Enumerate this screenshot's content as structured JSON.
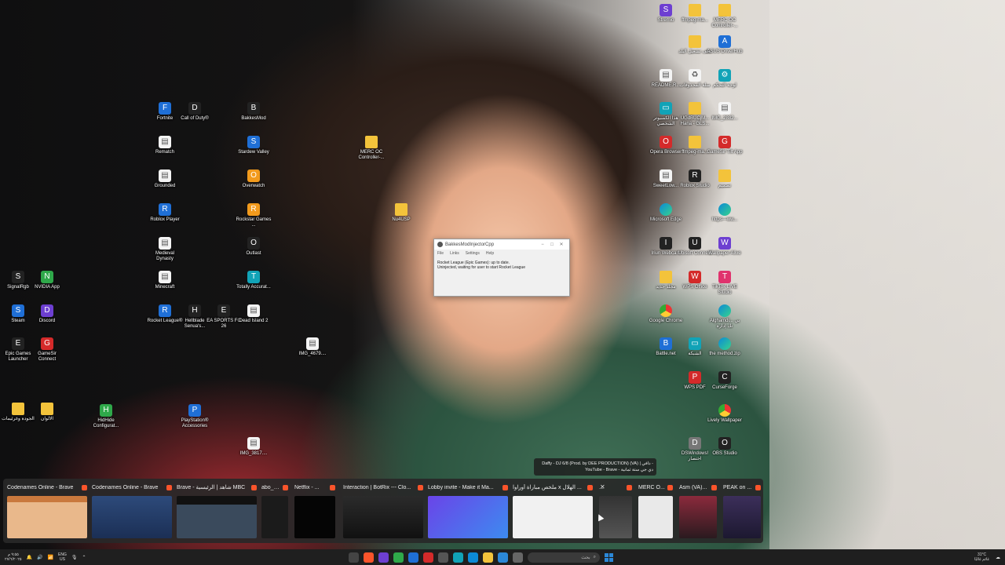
{
  "desktop": {
    "left_icons": [
      {
        "label": "Fortnite",
        "name": "fortnite",
        "cls": "g-blue",
        "glyph": "F"
      },
      {
        "label": "Call of Duty®",
        "name": "call-of-duty",
        "cls": "g-dark",
        "glyph": "D"
      },
      {
        "label": "BakkesMod",
        "name": "bakkesmod",
        "cls": "g-dark",
        "glyph": "B"
      },
      {
        "label": "Rematch",
        "name": "rematch",
        "cls": "g-file",
        "glyph": "▤"
      },
      {
        "label": "Stardew Valley",
        "name": "stardew-valley",
        "cls": "g-blue",
        "glyph": "S"
      },
      {
        "label": "Grounded",
        "name": "grounded",
        "cls": "g-file",
        "glyph": "▤"
      },
      {
        "label": "Overwatch",
        "name": "overwatch",
        "cls": "g-orange",
        "glyph": "O"
      },
      {
        "label": "Roblox Player",
        "name": "roblox-player",
        "cls": "g-blue",
        "glyph": "R"
      },
      {
        "label": "Rockstar Games ...",
        "name": "rockstar-games",
        "cls": "g-orange",
        "glyph": "R"
      },
      {
        "label": "Medieval Dynasty",
        "name": "medieval-dynasty",
        "cls": "g-file",
        "glyph": "▤"
      },
      {
        "label": "Outlast",
        "name": "outlast",
        "cls": "g-dark",
        "glyph": "O"
      },
      {
        "label": "Minecraft",
        "name": "minecraft",
        "cls": "g-file",
        "glyph": "▤"
      },
      {
        "label": "Totally Accurat...",
        "name": "totally-accurate",
        "cls": "g-teal",
        "glyph": "T"
      },
      {
        "label": "Rocket League®",
        "name": "rocket-league",
        "cls": "g-blue",
        "glyph": "R"
      },
      {
        "label": "Hellblade Senua's...",
        "name": "hellblade",
        "cls": "g-dark",
        "glyph": "H"
      },
      {
        "label": "EA SPORTS FC 26",
        "name": "ea-sports-fc",
        "cls": "g-dark",
        "glyph": "E"
      },
      {
        "label": "Dead Island 2",
        "name": "dead-island-2",
        "cls": "g-file",
        "glyph": "▤"
      },
      {
        "label": "SignalRgb",
        "name": "signalrgb",
        "cls": "g-dark",
        "glyph": "S"
      },
      {
        "label": "NVIDIA App",
        "name": "nvidia-app",
        "cls": "g-green",
        "glyph": "N"
      },
      {
        "label": "Steam",
        "name": "steam",
        "cls": "g-blue",
        "glyph": "S"
      },
      {
        "label": "Discord",
        "name": "discord",
        "cls": "g-purple",
        "glyph": "D"
      },
      {
        "label": "Epic Games Launcher",
        "name": "epic-games-launcher",
        "cls": "g-dark",
        "glyph": "E"
      },
      {
        "label": "GameSir Connect",
        "name": "gamesir-connect",
        "cls": "g-red",
        "glyph": "G"
      },
      {
        "label": "الجودة وغرئيمات",
        "name": "folder-arabic-1",
        "cls": "g-folder",
        "glyph": ""
      },
      {
        "label": "الالوان",
        "name": "folder-arabic-2",
        "cls": "g-folder",
        "glyph": ""
      },
      {
        "label": "HidHide Configurat...",
        "name": "hidhide",
        "cls": "g-green",
        "glyph": "H"
      },
      {
        "label": "PlayStation® Accessories",
        "name": "playstation-accessories",
        "cls": "g-blue",
        "glyph": "P"
      },
      {
        "label": "MERC OC Controller-...",
        "name": "merc-oc-folder",
        "cls": "g-folder",
        "glyph": ""
      },
      {
        "label": "Nu4USP",
        "name": "nu4usp-folder",
        "cls": "g-folder",
        "glyph": ""
      },
      {
        "label": "IMG_4679....",
        "name": "img-4679",
        "cls": "g-file",
        "glyph": "▤"
      },
      {
        "label": "IMG_3817....",
        "name": "img-3817",
        "cls": "g-file",
        "glyph": "▤"
      }
    ],
    "right_icons": [
      {
        "label": "Stremio",
        "name": "stremio",
        "cls": "g-purple",
        "glyph": "S"
      },
      {
        "label": "ffmpeg-ma...",
        "name": "ffmpeg-folder-1",
        "cls": "g-folder",
        "glyph": ""
      },
      {
        "label": "MERC OC Controller-...",
        "name": "merc-oc-controller",
        "cls": "g-folder",
        "glyph": ""
      },
      {
        "label": "ملف تشغيل البلد",
        "name": "arabic-folder-3",
        "cls": "g-folder",
        "glyph": ""
      },
      {
        "label": "ASUS DriverHub",
        "name": "asus-driverhub",
        "cls": "g-blue",
        "glyph": "A"
      },
      {
        "label": "README.R...",
        "name": "readme",
        "cls": "g-file",
        "glyph": "▤"
      },
      {
        "label": "سلة المحذوفات",
        "name": "recycle-bin",
        "cls": "g-file",
        "glyph": "♻"
      },
      {
        "label": "لوحة التحكم",
        "name": "control-panel",
        "cls": "g-teal",
        "glyph": "⚙"
      },
      {
        "label": "هذا الكمبيوتر الشخصي",
        "name": "this-pc",
        "cls": "g-teal",
        "glyph": "▭"
      },
      {
        "label": "UGdBUCjM... Hana - GLS...",
        "name": "ugd-folder",
        "cls": "g-folder",
        "glyph": ""
      },
      {
        "label": "IMG_2882...",
        "name": "img-2882",
        "cls": "g-file",
        "glyph": "▤"
      },
      {
        "label": "Opera Browser",
        "name": "opera-browser",
        "cls": "g-red",
        "glyph": "O"
      },
      {
        "label": "ffmpeg-ma...",
        "name": "ffmpeg-folder-2",
        "cls": "g-folder",
        "glyph": ""
      },
      {
        "label": "GameSir Tilt App",
        "name": "gamesir-tilt",
        "cls": "g-red",
        "glyph": "G"
      },
      {
        "label": "SweetLow...",
        "name": "sweetlow",
        "cls": "g-file",
        "glyph": "▤"
      },
      {
        "label": "Roblox Studio",
        "name": "roblox-studio",
        "cls": "g-dark",
        "glyph": "R"
      },
      {
        "label": "تصميم",
        "name": "design-folder",
        "cls": "g-folder",
        "glyph": ""
      },
      {
        "label": "Microsoft Edge",
        "name": "microsoft-edge",
        "cls": "g-edge",
        "glyph": ""
      },
      {
        "label": "https---ww...",
        "name": "https-shortcut",
        "cls": "g-edge",
        "glyph": ""
      },
      {
        "label": "Iriun Webcam",
        "name": "iriun-webcam",
        "cls": "g-dark",
        "glyph": "I"
      },
      {
        "label": "Ubisoft Connect",
        "name": "ubisoft-connect",
        "cls": "g-dark",
        "glyph": "U"
      },
      {
        "label": "Wallpaper Alive",
        "name": "wallpaper-alive",
        "cls": "g-purple",
        "glyph": "W"
      },
      {
        "label": "مجلد جديد",
        "name": "new-folder",
        "cls": "g-folder",
        "glyph": ""
      },
      {
        "label": "WPS Office",
        "name": "wps-office",
        "cls": "g-red",
        "glyph": "W"
      },
      {
        "label": "TikTok LIVE Studio",
        "name": "tiktok-live-studio",
        "cls": "g-pink",
        "glyph": "T"
      },
      {
        "label": "Google Chrome",
        "name": "google-chrome",
        "cls": "g-chrome",
        "glyph": ""
      },
      {
        "label": "Alghamdi... بي تك إدارة",
        "name": "alghamdi-shortcut",
        "cls": "g-edge",
        "glyph": ""
      },
      {
        "label": "Battle.net",
        "name": "battle-net",
        "cls": "g-blue",
        "glyph": "B"
      },
      {
        "label": "الشبكة",
        "name": "network",
        "cls": "g-teal",
        "glyph": "▭"
      },
      {
        "label": "the method.zip",
        "name": "the-method-zip",
        "cls": "g-edge",
        "glyph": ""
      },
      {
        "label": "WPS PDF",
        "name": "wps-pdf",
        "cls": "g-red",
        "glyph": "P"
      },
      {
        "label": "CurseForge",
        "name": "curseforge",
        "cls": "g-dark",
        "glyph": "C"
      },
      {
        "label": "Lively Wallpaper",
        "name": "lively-wallpaper",
        "cls": "g-chrome",
        "glyph": ""
      },
      {
        "label": "DSWindows! اختصار",
        "name": "dswindows",
        "cls": "g-gray",
        "glyph": "D"
      },
      {
        "label": "OBS Studio",
        "name": "obs-studio",
        "cls": "g-dark",
        "glyph": "O"
      }
    ]
  },
  "dialog": {
    "title": "BakkesModInjectorCpp",
    "menu": [
      "File",
      "Links",
      "Settings",
      "Help"
    ],
    "line1": "Rocket League (Epic Games): up to date.",
    "line2": "Uninjected, waiting for user to start Rocket League"
  },
  "media_tooltip": {
    "line1": "Daffy - DJ 6/8 (Prod. by DEE PRODUCTION) (VA) | دافي -",
    "line2": "YouTube - Brave - دي جي ستة ثمانية"
  },
  "switcher": {
    "windows": [
      {
        "label": "Codenames Online - Brave",
        "preview": "p-game"
      },
      {
        "label": "Codenames Online - Brave",
        "preview": "p-game2"
      },
      {
        "label": "Brave - شاهد | الرئيسية MBC",
        "preview": "p-mbc"
      },
      {
        "label": "abo_qa...",
        "preview": "p-dark"
      },
      {
        "label": "Netflix - ...",
        "preview": "p-black"
      },
      {
        "label": "Interaction | BotRix --- Clo...",
        "preview": "p-interaction"
      },
      {
        "label": "Lobby invite - Make it Ma...",
        "preview": "p-purple"
      },
      {
        "label": "ملخص مباراة أوراوا x الهلال ...",
        "preview": "p-white"
      },
      {
        "label": "...",
        "preview": "p-multi"
      },
      {
        "label": "MERC O...",
        "preview": "p-doc"
      },
      {
        "label": "Asm (VA)...",
        "preview": "p-asm"
      },
      {
        "label": "PEAK on ...",
        "preview": "p-peak"
      }
    ]
  },
  "taskbar": {
    "weather_temp": "31°C",
    "weather_desc": "غائم غالبًا",
    "search_placeholder": "بحث",
    "lang_top": "ENG",
    "lang_bottom": "US",
    "time": "٩:٥٥ م",
    "date": "٢٧/٦/٢٠٢٥"
  }
}
